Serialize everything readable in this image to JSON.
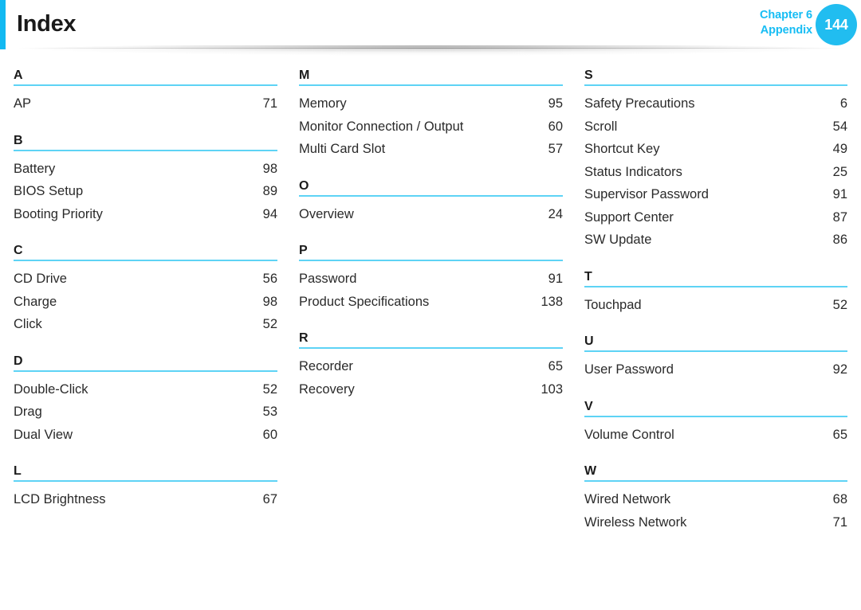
{
  "header": {
    "title": "Index",
    "chapter_line1": "Chapter 6",
    "chapter_line2": "Appendix",
    "page_number": "144",
    "accent_color": "#12b9f2",
    "badge_color": "#21bdf0",
    "rule_color": "#5ed3f5"
  },
  "index": {
    "columns": [
      {
        "groups": [
          {
            "letter": "A",
            "entries": [
              {
                "name": "AP",
                "page": "71"
              }
            ]
          },
          {
            "letter": "B",
            "entries": [
              {
                "name": "Battery",
                "page": "98"
              },
              {
                "name": "BIOS Setup",
                "page": "89"
              },
              {
                "name": "Booting Priority",
                "page": "94"
              }
            ]
          },
          {
            "letter": "C",
            "entries": [
              {
                "name": "CD Drive",
                "page": "56"
              },
              {
                "name": "Charge",
                "page": "98"
              },
              {
                "name": "Click",
                "page": "52"
              }
            ]
          },
          {
            "letter": "D",
            "entries": [
              {
                "name": "Double-Click",
                "page": "52"
              },
              {
                "name": "Drag",
                "page": "53"
              },
              {
                "name": "Dual View",
                "page": "60"
              }
            ]
          },
          {
            "letter": "L",
            "entries": [
              {
                "name": "LCD Brightness",
                "page": "67"
              }
            ]
          }
        ]
      },
      {
        "groups": [
          {
            "letter": "M",
            "entries": [
              {
                "name": "Memory",
                "page": "95"
              },
              {
                "name": "Monitor Connection / Output",
                "page": "60"
              },
              {
                "name": "Multi Card Slot",
                "page": "57"
              }
            ]
          },
          {
            "letter": "O",
            "entries": [
              {
                "name": "Overview",
                "page": "24"
              }
            ]
          },
          {
            "letter": "P",
            "entries": [
              {
                "name": "Password",
                "page": "91"
              },
              {
                "name": "Product Specifications",
                "page": "138"
              }
            ]
          },
          {
            "letter": "R",
            "entries": [
              {
                "name": "Recorder",
                "page": "65"
              },
              {
                "name": "Recovery",
                "page": "103"
              }
            ]
          }
        ]
      },
      {
        "groups": [
          {
            "letter": "S",
            "entries": [
              {
                "name": "Safety Precautions",
                "page": "6"
              },
              {
                "name": "Scroll",
                "page": "54"
              },
              {
                "name": "Shortcut Key",
                "page": "49"
              },
              {
                "name": "Status Indicators",
                "page": "25"
              },
              {
                "name": "Supervisor Password",
                "page": "91"
              },
              {
                "name": "Support Center",
                "page": "87"
              },
              {
                "name": "SW Update",
                "page": "86"
              }
            ]
          },
          {
            "letter": "T",
            "entries": [
              {
                "name": "Touchpad",
                "page": "52"
              }
            ]
          },
          {
            "letter": "U",
            "entries": [
              {
                "name": "User Password",
                "page": "92"
              }
            ]
          },
          {
            "letter": "V",
            "entries": [
              {
                "name": "Volume Control",
                "page": "65"
              }
            ]
          },
          {
            "letter": "W",
            "entries": [
              {
                "name": "Wired Network",
                "page": "68"
              },
              {
                "name": "Wireless Network",
                "page": "71"
              }
            ]
          }
        ]
      }
    ]
  }
}
